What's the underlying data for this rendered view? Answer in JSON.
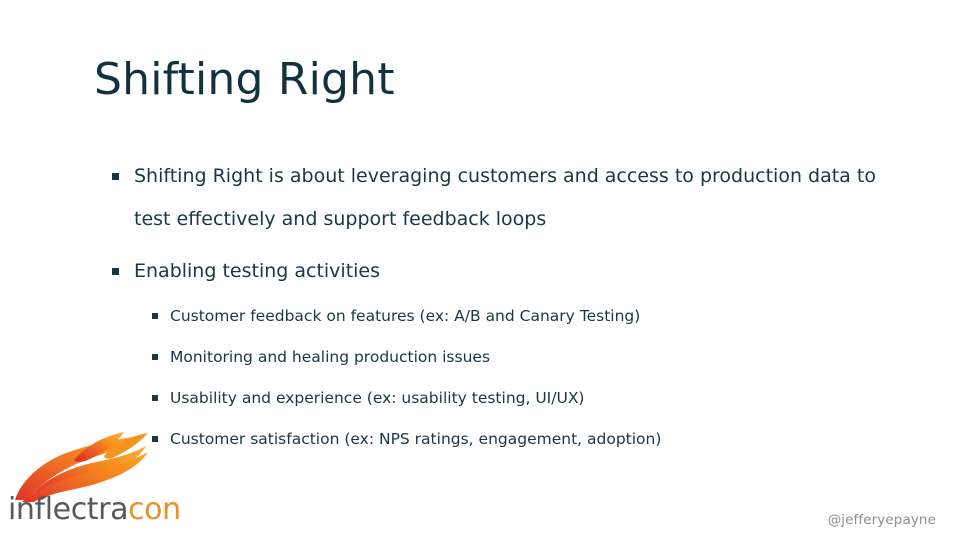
{
  "slide": {
    "background_color": "#ffffff",
    "title": "Shifting Right",
    "title_color": "#12323e",
    "body_text_color": "#1b3743"
  },
  "body": {
    "bullets": [
      {
        "level": 1,
        "text": "Shifting Right is about leveraging customers and access to production data to test effectively and support feedback loops"
      },
      {
        "level": 1,
        "text": "Enabling testing activities"
      },
      {
        "level": 2,
        "text": "Customer feedback on features (ex: A/B and Canary Testing)"
      },
      {
        "level": 2,
        "text": "Monitoring and healing production issues"
      },
      {
        "level": 2,
        "text": "Usability and experience (ex: usability testing, UI/UX)"
      },
      {
        "level": 2,
        "text": "Customer satisfaction (ex: NPS ratings, engagement, adoption)"
      }
    ]
  },
  "logo": {
    "icon_name": "flame-icon",
    "wordmark_primary": "inflectra",
    "wordmark_accent": "con",
    "primary_color": "#58595b",
    "accent_color": "#e8932a",
    "flame_color_start": "#e0322b",
    "flame_color_end": "#f9a825"
  },
  "footer": {
    "handle": "@jefferyepayne",
    "handle_color": "#8d8d8d"
  }
}
